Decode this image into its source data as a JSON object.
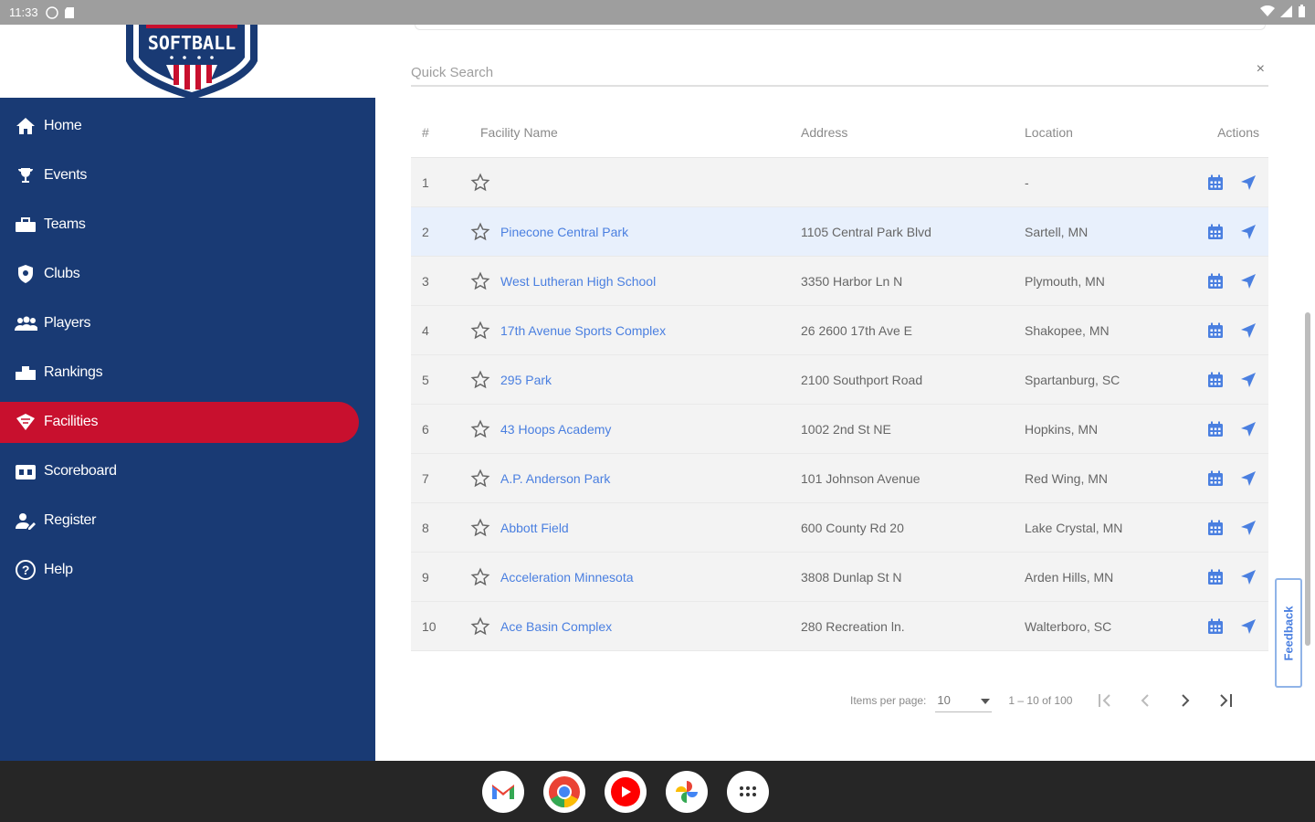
{
  "status_bar": {
    "time": "11:33"
  },
  "logo": {
    "text": "SOFTBALL"
  },
  "nav": {
    "items": [
      {
        "label": "Home",
        "icon": "home-icon",
        "active": false
      },
      {
        "label": "Events",
        "icon": "trophy-icon",
        "active": false
      },
      {
        "label": "Teams",
        "icon": "teams-icon",
        "active": false
      },
      {
        "label": "Clubs",
        "icon": "shield-icon",
        "active": false
      },
      {
        "label": "Players",
        "icon": "players-icon",
        "active": false
      },
      {
        "label": "Rankings",
        "icon": "rankings-icon",
        "active": false
      },
      {
        "label": "Facilities",
        "icon": "facility-icon",
        "active": true
      },
      {
        "label": "Scoreboard",
        "icon": "scoreboard-icon",
        "active": false
      },
      {
        "label": "Register",
        "icon": "register-icon",
        "active": false
      },
      {
        "label": "Help",
        "icon": "help-icon",
        "active": false
      }
    ]
  },
  "search": {
    "placeholder": "Quick Search",
    "clear_glyph": "×"
  },
  "table": {
    "headers": {
      "num": "#",
      "name": "Facility Name",
      "address": "Address",
      "location": "Location",
      "actions": "Actions"
    },
    "rows": [
      {
        "num": "1",
        "name": "",
        "address": "",
        "location": "-"
      },
      {
        "num": "2",
        "name": "Pinecone Central Park",
        "address": "1105 Central Park Blvd",
        "location": "Sartell, MN"
      },
      {
        "num": "3",
        "name": "West Lutheran High School",
        "address": "3350 Harbor Ln N",
        "location": "Plymouth, MN"
      },
      {
        "num": "4",
        "name": "17th Avenue Sports Complex",
        "address": "26 2600 17th Ave E",
        "location": "Shakopee, MN"
      },
      {
        "num": "5",
        "name": "295 Park",
        "address": "2100 Southport Road",
        "location": "Spartanburg, SC"
      },
      {
        "num": "6",
        "name": "43 Hoops Academy",
        "address": "1002 2nd St NE",
        "location": "Hopkins, MN"
      },
      {
        "num": "7",
        "name": "A.P. Anderson Park",
        "address": "101 Johnson Avenue",
        "location": "Red Wing, MN"
      },
      {
        "num": "8",
        "name": "Abbott Field",
        "address": "600 County Rd 20",
        "location": "Lake Crystal, MN"
      },
      {
        "num": "9",
        "name": "Acceleration Minnesota",
        "address": "3808 Dunlap St N",
        "location": "Arden Hills, MN"
      },
      {
        "num": "10",
        "name": "Ace Basin Complex",
        "address": "280 Recreation ln.",
        "location": "Walterboro, SC"
      }
    ]
  },
  "paginator": {
    "items_per_page_label": "Items per page:",
    "items_per_page": "10",
    "range": "1 – 10 of 100"
  },
  "feedback": {
    "label": "Feedback"
  },
  "colors": {
    "sidebar": "#193a74",
    "active": "#c8102e",
    "link": "#4a7fe0"
  }
}
